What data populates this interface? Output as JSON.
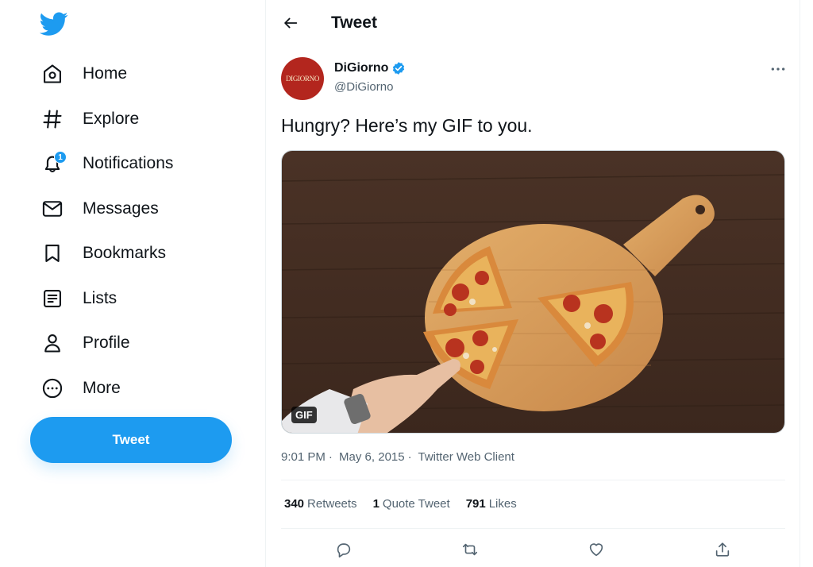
{
  "nav": {
    "items": [
      {
        "label": "Home",
        "icon": "home-icon"
      },
      {
        "label": "Explore",
        "icon": "hashtag-icon"
      },
      {
        "label": "Notifications",
        "icon": "bell-icon",
        "badge": "1"
      },
      {
        "label": "Messages",
        "icon": "envelope-icon"
      },
      {
        "label": "Bookmarks",
        "icon": "bookmark-icon"
      },
      {
        "label": "Lists",
        "icon": "list-icon"
      },
      {
        "label": "Profile",
        "icon": "person-icon"
      },
      {
        "label": "More",
        "icon": "more-circle-icon"
      }
    ],
    "tweet_button": "Tweet"
  },
  "header": {
    "title": "Tweet"
  },
  "tweet": {
    "author_name": "DiGiorno",
    "author_handle": "@DiGiorno",
    "avatar_text": "DIGIORNO",
    "text": "Hungry? Here’s my GIF to you.",
    "media_badge": "GIF",
    "time": "9:01 PM",
    "date": "May 6, 2015",
    "client": "Twitter Web Client",
    "separator": "·",
    "stats": {
      "retweets_count": "340",
      "retweets_label": "Retweets",
      "quotes_count": "1",
      "quotes_label": "Quote Tweet",
      "likes_count": "791",
      "likes_label": "Likes"
    }
  },
  "colors": {
    "brand": "#1d9bf0",
    "text": "#0f1419",
    "muted": "#536471",
    "avatar_bg": "#b3261e"
  }
}
